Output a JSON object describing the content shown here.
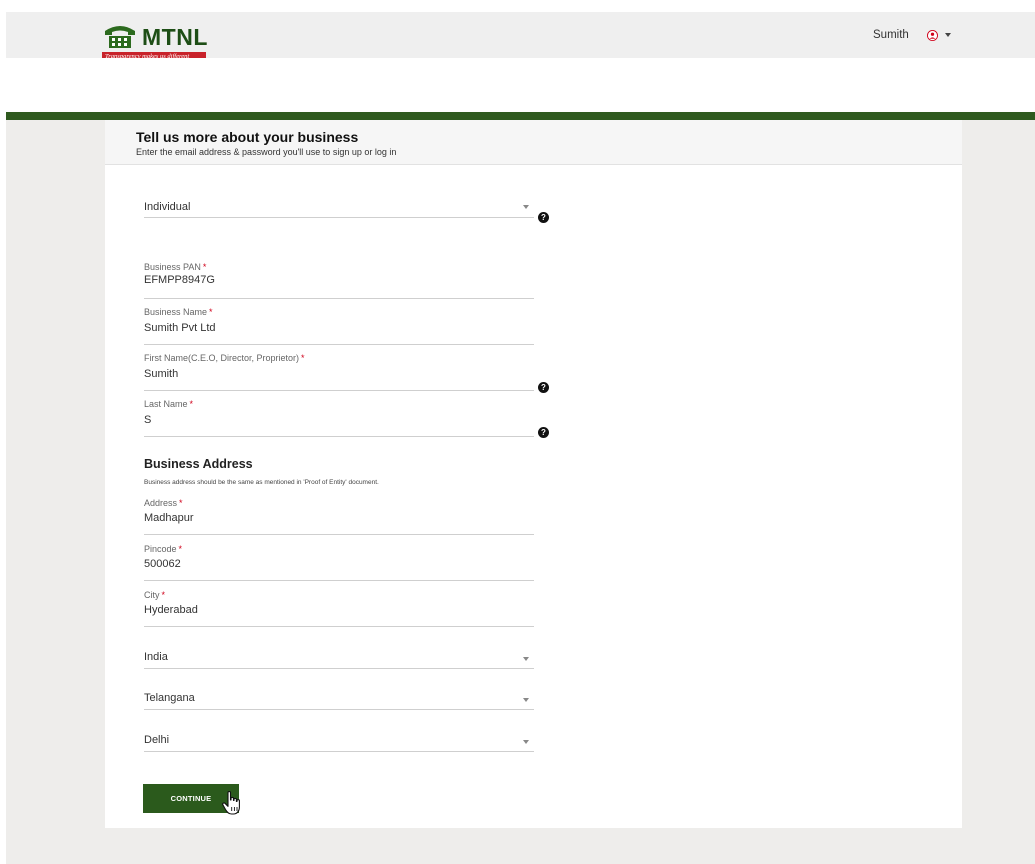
{
  "header": {
    "brand": "MTNL",
    "tagline": "Transparency makes us different",
    "user_name": "Sumith",
    "user_icon": "user-circle-icon",
    "menu_icon": "caret-down-icon"
  },
  "form": {
    "title": "Tell us more about your business",
    "subtitle": "Enter the email address & password you'll use to sign up or log in",
    "entity_type": "Individual",
    "business_pan_label": "Business PAN",
    "business_pan": "EFMPP8947G",
    "business_name_label": "Business Name",
    "business_name": "Sumith Pvt Ltd",
    "first_name_label": "First Name(C.E.O, Director, Proprietor)",
    "first_name": "Sumith",
    "last_name_label": "Last Name",
    "last_name": "S",
    "required_mark": "*",
    "help_icon": "question-circle-icon",
    "help_glyph": "?"
  },
  "address": {
    "title": "Business Address",
    "note": "Business address should be the same as mentioned in 'Proof of Entity' document.",
    "address_label": "Address",
    "address": "Madhapur",
    "pincode_label": "Pincode",
    "pincode": "500062",
    "city_label": "City",
    "city": "Hyderabad",
    "country": "India",
    "state": "Telangana",
    "district": "Delhi"
  },
  "actions": {
    "continue_label": "CONTINUE"
  },
  "colors": {
    "brand_green": "#2b5a1c",
    "required_red": "#d0021b",
    "tagline_red": "#c8222a"
  }
}
